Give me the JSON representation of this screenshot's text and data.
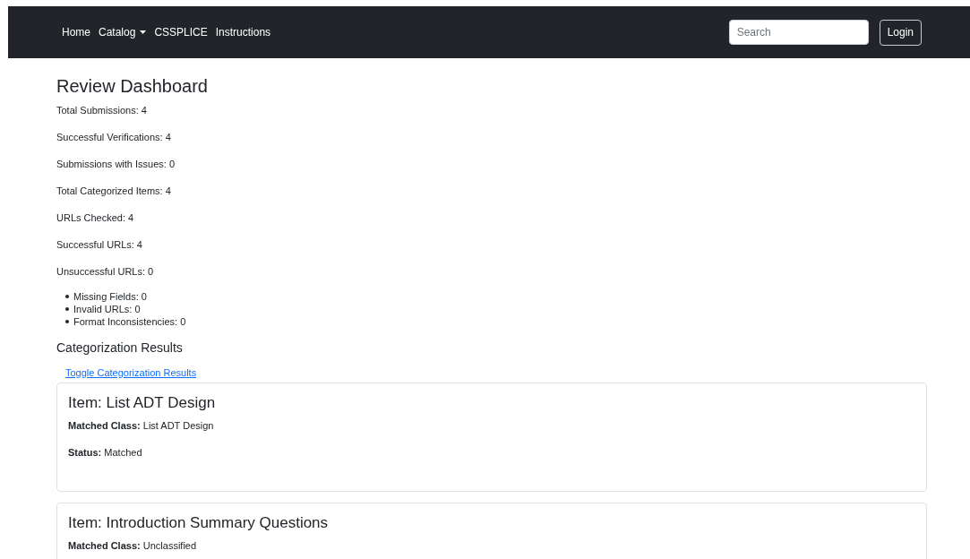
{
  "navbar": {
    "links": [
      {
        "label": "Home",
        "kind": "link"
      },
      {
        "label": "Catalog",
        "kind": "dropdown"
      },
      {
        "label": "CSSPLICE",
        "kind": "link"
      },
      {
        "label": "Instructions",
        "kind": "link"
      }
    ],
    "search": {
      "placeholder": "Search"
    },
    "login_button": "Login"
  },
  "dashboard": {
    "title": "Review Dashboard",
    "stats": [
      "Total Submissions: 4",
      "Successful Verifications: 4",
      "Submissions with Issues: 0",
      "Total Categorized Items: 4",
      "URLs Checked: 4",
      "Successful URLs: 4",
      "Unsuccessful URLs: 0"
    ],
    "issues": [
      "Missing Fields: 0",
      "Invalid URLs: 0",
      "Format Inconsistencies: 0"
    ]
  },
  "categorization": {
    "title": "Categorization Results",
    "toggle_link": "Toggle Categorization Results",
    "items": [
      {
        "title": "Item: List ADT Design",
        "fields": [
          {
            "label": "Matched Class:",
            "value": "List ADT Design"
          },
          {
            "label": "Status:",
            "value": "Matched"
          }
        ]
      },
      {
        "title": "Item: Introduction Summary Questions",
        "fields": [
          {
            "label": "Matched Class:",
            "value": "Unclassified"
          }
        ]
      }
    ]
  }
}
